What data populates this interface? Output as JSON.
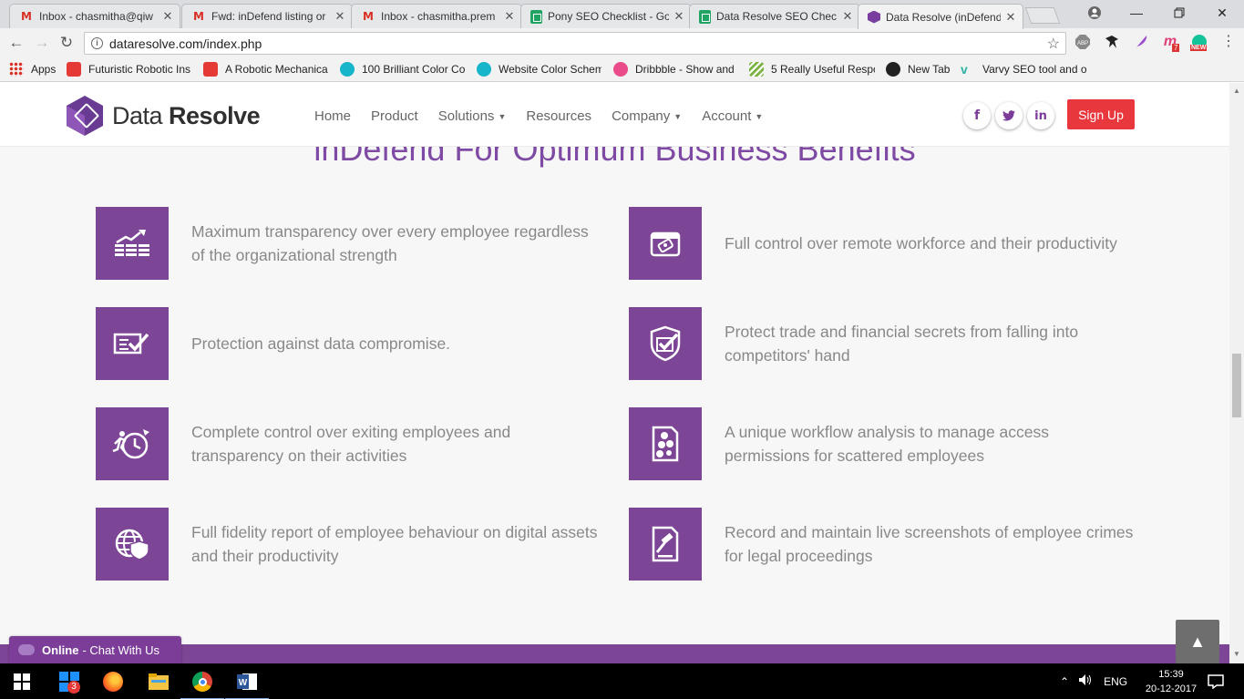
{
  "browser": {
    "tabs": [
      {
        "title": "Inbox - chasmitha@qiw",
        "icon": "gmail-icon"
      },
      {
        "title": "Fwd: inDefend listing or",
        "icon": "gmail-icon"
      },
      {
        "title": "Inbox - chasmitha.prem",
        "icon": "gmail-icon"
      },
      {
        "title": "Pony SEO Checklist - Go",
        "icon": "sheets-icon"
      },
      {
        "title": "Data Resolve SEO Chec",
        "icon": "sheets-icon"
      },
      {
        "title": "Data Resolve (inDefend",
        "icon": "dataresolve-icon"
      }
    ],
    "url": "dataresolve.com/index.php",
    "bookmarks": [
      {
        "label": "Apps"
      },
      {
        "label": "Futuristic Robotic Ins"
      },
      {
        "label": "A Robotic Mechanica"
      },
      {
        "label": "100 Brilliant Color Co"
      },
      {
        "label": "Website Color Schem"
      },
      {
        "label": "Dribbble - Show and"
      },
      {
        "label": "5 Really Useful Respo"
      },
      {
        "label": "New Tab"
      },
      {
        "label": "Varvy SEO tool and o"
      }
    ],
    "extensions": {
      "badge_m": "7",
      "badge_new": "NEW",
      "abp": "ABP"
    }
  },
  "site": {
    "logo": {
      "first": "Data ",
      "second": "Resolve"
    },
    "nav": [
      {
        "label": "Home"
      },
      {
        "label": "Product"
      },
      {
        "label": "Solutions",
        "dropdown": true
      },
      {
        "label": "Resources"
      },
      {
        "label": "Company",
        "dropdown": true
      },
      {
        "label": "Account",
        "dropdown": true
      }
    ],
    "social": {
      "facebook": "f",
      "twitter": "t",
      "linkedin": "in"
    },
    "signup_label": "Sign Up",
    "section_title": "inDefend For Optimum Business Benefits",
    "features": [
      {
        "text": "Maximum transparency over every employee regardless of the organizational strength",
        "icon": "growth-chart-icon"
      },
      {
        "text": "Full control over remote workforce and their productivity",
        "icon": "remote-device-icon"
      },
      {
        "text": "Protection against data compromise.",
        "icon": "checked-document-icon"
      },
      {
        "text": "Protect trade and financial secrets from falling into competitors' hand",
        "icon": "shield-check-icon"
      },
      {
        "text": "Complete control over exiting employees and transparency on their activities",
        "icon": "exit-timer-icon"
      },
      {
        "text": "A unique workflow analysis to manage access permissions for scattered employees",
        "icon": "workflow-icon"
      },
      {
        "text": "Full fidelity report of employee behaviour on digital assets and their productivity",
        "icon": "globe-shield-icon"
      },
      {
        "text": "Record and maintain live screenshots of employee crimes for legal proceedings",
        "icon": "legal-document-icon"
      }
    ],
    "chat": {
      "status": "Online",
      "label": "- Chat With Us"
    },
    "back_to_top": "▲"
  },
  "taskbar": {
    "store_badge": "3",
    "lang": "ENG",
    "time": "15:39",
    "date": "20-12-2017"
  },
  "colors": {
    "brand_purple": "#7d4595",
    "signup_red": "#e8373d",
    "title_purple": "#7e4aa3"
  }
}
